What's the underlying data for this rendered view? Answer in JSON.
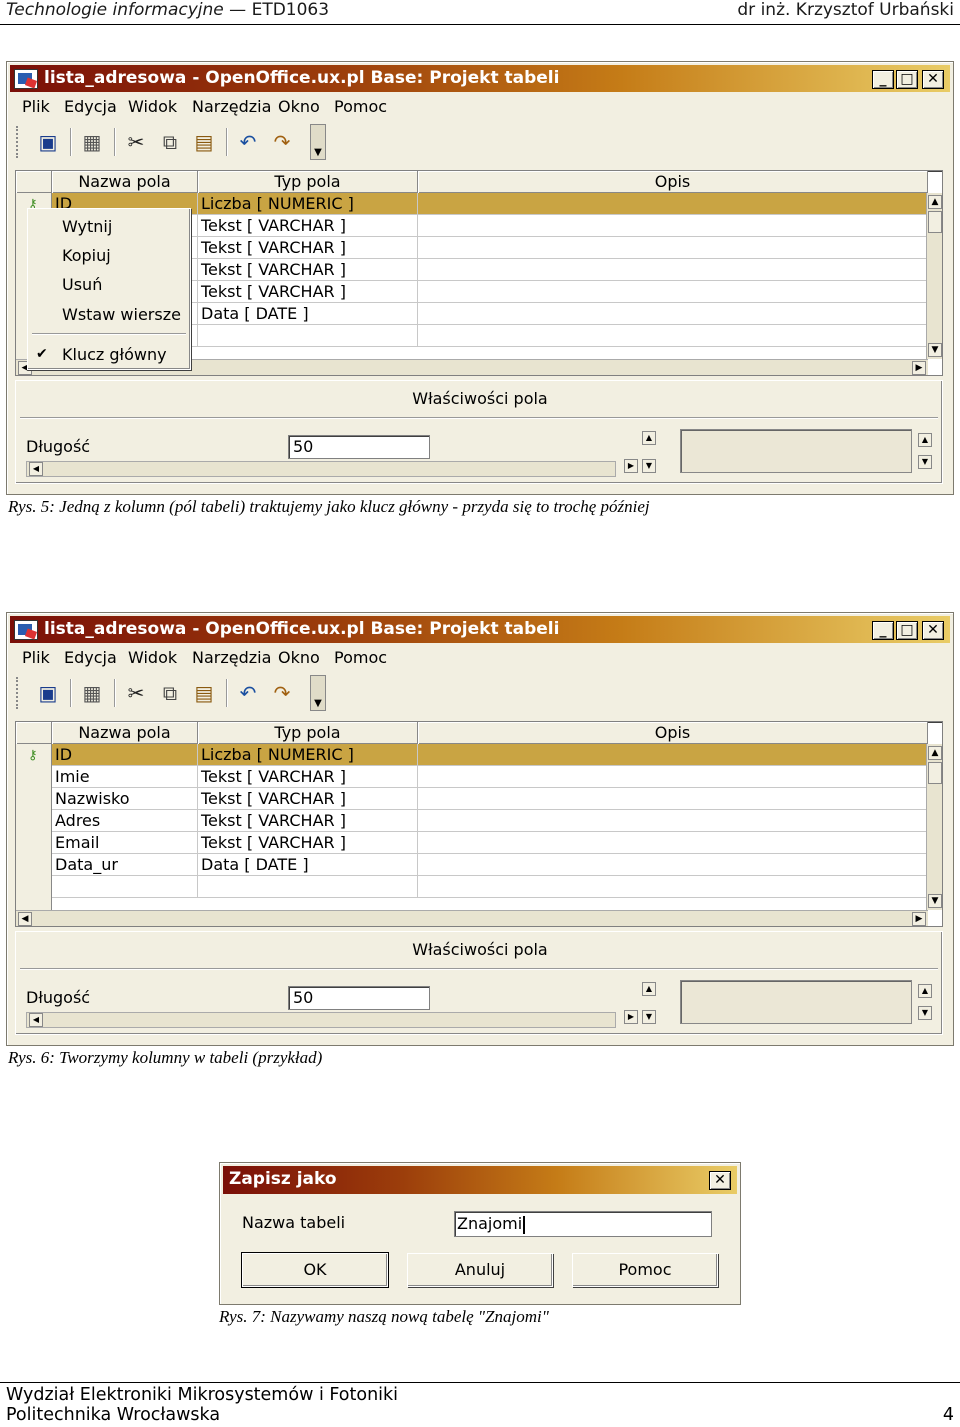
{
  "header": {
    "course_prefix": "Technologie informacyjne",
    "course_code": "ETD1063",
    "author": "dr inż. Krzysztof Urbański"
  },
  "window": {
    "title": "lista_adresowa - OpenOffice.ux.pl Base: Projekt tabeli",
    "menu": [
      "Plik",
      "Edycja",
      "Widok",
      "Narzędzia",
      "Okno",
      "Pomoc"
    ],
    "grid_headers": [
      "Nazwa pola",
      "Typ pola",
      "Opis"
    ],
    "properties_title": "Właściwości pola",
    "length_label": "Długość",
    "length_value": "50"
  },
  "figure1": {
    "rows": [
      {
        "name": "ID",
        "type": "Liczba [ NUMERIC ]"
      },
      {
        "name": "",
        "type": "Tekst [ VARCHAR ]"
      },
      {
        "name": "",
        "type": "Tekst [ VARCHAR ]"
      },
      {
        "name": "",
        "type": "Tekst [ VARCHAR ]"
      },
      {
        "name": "",
        "type": "Tekst [ VARCHAR ]"
      },
      {
        "name": "",
        "type": "Data [ DATE ]"
      }
    ],
    "context_menu": [
      "Wytnij",
      "Kopiuj",
      "Usuń",
      "Wstaw wiersze",
      "Klucz główny"
    ],
    "caption": "Rys. 5: Jedną z kolumn (pól tabeli) traktujemy jako klucz główny - przyda się to trochę później"
  },
  "figure2": {
    "rows": [
      {
        "name": "ID",
        "type": "Liczba [ NUMERIC ]"
      },
      {
        "name": "Imie",
        "type": "Tekst [ VARCHAR ]"
      },
      {
        "name": "Nazwisko",
        "type": "Tekst [ VARCHAR ]"
      },
      {
        "name": "Adres",
        "type": "Tekst [ VARCHAR ]"
      },
      {
        "name": "Email",
        "type": "Tekst [ VARCHAR ]"
      },
      {
        "name": "Data_ur",
        "type": "Data [ DATE ]"
      }
    ],
    "caption": "Rys. 6: Tworzymy kolumny w tabeli (przykład)"
  },
  "dialog": {
    "title": "Zapisz jako",
    "label": "Nazwa tabeli",
    "value": "Znajomi",
    "buttons": [
      "OK",
      "Anuluj",
      "Pomoc"
    ],
    "caption": "Rys. 7: Nazywamy naszą nową tabelę \"Znajomi\""
  },
  "footer": {
    "line1": "Wydział Elektroniki Mikrosystemów i Fotoniki",
    "line2": "Politechnika Wrocławska",
    "page": "4"
  }
}
